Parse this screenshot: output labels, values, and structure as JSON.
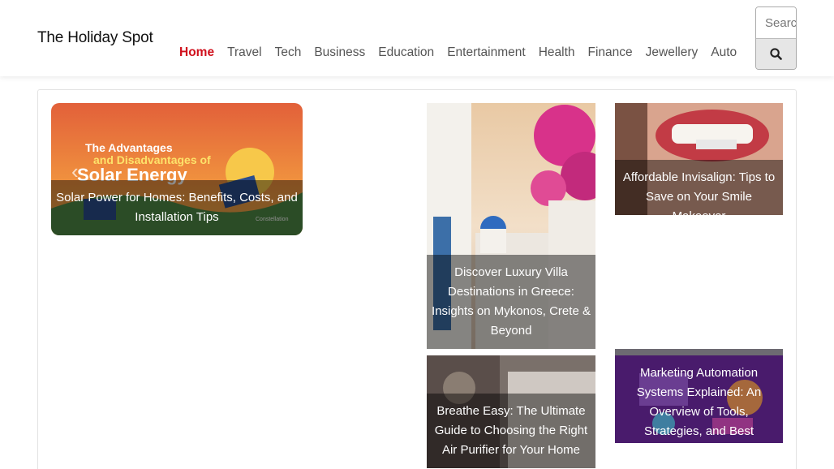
{
  "header": {
    "brand": "The Holiday Spot",
    "nav": [
      "Home",
      "Travel",
      "Tech",
      "Business",
      "Education",
      "Entertainment",
      "Health",
      "Finance",
      "Jewellery",
      "Auto"
    ],
    "search_placeholder": "Search"
  },
  "slider": {
    "image_title_line1": "The Advantages",
    "image_title_line2": "and Disadvantages of",
    "image_title_line3": "Solar Energy",
    "image_brand": "Constellation",
    "caption": "Solar Power for Homes: Benefits, Costs, and Installation Tips"
  },
  "cards": [
    {
      "caption": "Discover Luxury Villa Destinations in Greece: Insights on Mykonos, Crete & Beyond"
    },
    {
      "caption": "Affordable Invisalign: Tips to Save on Your Smile Makeover"
    },
    {
      "caption": "Breathe Easy: The Ultimate Guide to Choosing the Right Air Purifier for Your Home"
    },
    {
      "caption": "Marketing Automation Systems Explained: An Overview of Tools, Strategies, and Best Practices"
    }
  ]
}
